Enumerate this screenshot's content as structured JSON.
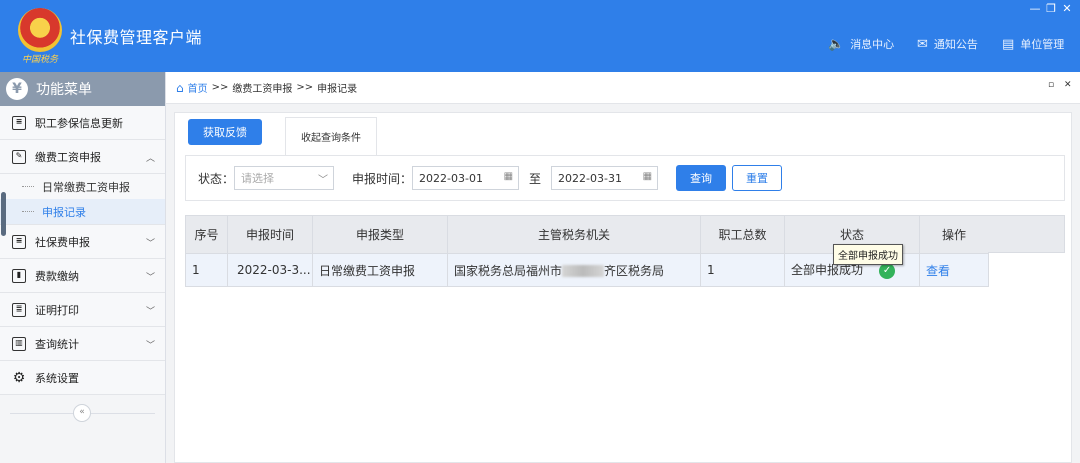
{
  "app": {
    "title": "社保费管理客户端",
    "logo_text": "中国税务",
    "window_controls": [
      "—",
      "❐",
      "✕"
    ]
  },
  "top_menu": [
    {
      "icon": "🔈",
      "label": "消息中心"
    },
    {
      "icon": "✉",
      "label": "通知公告"
    },
    {
      "icon": "▤",
      "label": "单位管理"
    }
  ],
  "sidebar": {
    "header": "功能菜单",
    "items": [
      {
        "label": "职工参保信息更新"
      },
      {
        "label": "缴费工资申报",
        "expanded": true,
        "children": [
          {
            "label": "日常缴费工资申报"
          },
          {
            "label": "申报记录",
            "active": true
          }
        ]
      },
      {
        "label": "社保费申报"
      },
      {
        "label": "费款缴纳"
      },
      {
        "label": "证明打印"
      },
      {
        "label": "查询统计"
      },
      {
        "label": "系统设置"
      }
    ],
    "collapse_glyph": "«"
  },
  "breadcrumb": {
    "home": "首页",
    "sep": ">>",
    "level1": "缴费工资申报",
    "level2": "申报记录"
  },
  "toolbar": {
    "feedback_button": "获取反馈",
    "collapse_tab": "收起查询条件"
  },
  "filter": {
    "status_label": "状态：",
    "status_placeholder": "请选择",
    "time_label": "申报时间：",
    "start_date": "2022-03-01",
    "to_label": "至",
    "end_date": "2022-03-31",
    "query_button": "查询",
    "reset_button": "重置"
  },
  "table": {
    "headers": [
      "序号",
      "申报时间",
      "申报类型",
      "主管税务机关",
      "职工总数",
      "状态",
      "操作"
    ],
    "rows": [
      {
        "index": "1",
        "time": "2022-03-3...",
        "type": "日常缴费工资申报",
        "office_prefix": "国家税务总局福州市",
        "office_suffix": "齐区税务局",
        "employees": "1",
        "status": "全部申报成功",
        "action": "查看"
      }
    ]
  },
  "tooltip": "全部申报成功",
  "colors": {
    "primary": "#2f7fe9",
    "success": "#33b25a",
    "sidebar_header": "#8b9aad"
  }
}
